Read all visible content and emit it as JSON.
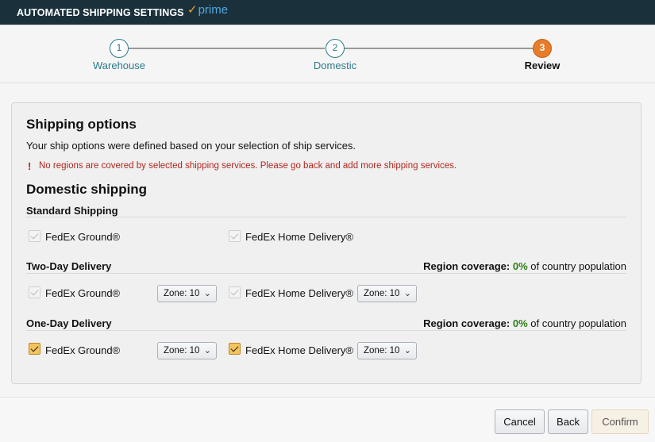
{
  "header": {
    "title": "AUTOMATED SHIPPING SETTINGS",
    "prime_check": "✓",
    "prime_text": "prime"
  },
  "steps": [
    {
      "number": "1",
      "label": "Warehouse"
    },
    {
      "number": "2",
      "label": "Domestic"
    },
    {
      "number": "3",
      "label": "Review"
    }
  ],
  "shipping_options": {
    "title": "Shipping options",
    "description": "Your ship options were defined based on your selection of ship services.",
    "error_icon": "!",
    "error": "No regions are covered by selected shipping services. Please go back and add more shipping services."
  },
  "domestic": {
    "title": "Domestic shipping",
    "standard": {
      "label": "Standard Shipping",
      "services": [
        "FedEx Ground®",
        "FedEx Home Delivery®"
      ]
    },
    "two_day": {
      "label": "Two-Day Delivery",
      "coverage_label": "Region coverage:",
      "coverage_pct": "0%",
      "coverage_suffix": "of country population",
      "services": [
        "FedEx Ground®",
        "FedEx Home Delivery®"
      ],
      "zones": [
        "Zone: 10",
        "Zone: 10"
      ]
    },
    "one_day": {
      "label": "One-Day Delivery",
      "coverage_label": "Region coverage:",
      "coverage_pct": "0%",
      "coverage_suffix": "of country population",
      "services": [
        "FedEx Ground®",
        "FedEx Home Delivery®"
      ],
      "zones": [
        "Zone: 10",
        "Zone: 10"
      ]
    }
  },
  "footer": {
    "cancel": "Cancel",
    "back": "Back",
    "confirm": "Confirm"
  },
  "colors": {
    "header_bg": "#1a313c",
    "active_step": "#e77c2a",
    "step_link": "#2b7b8a",
    "error": "#b3261e",
    "coverage_pct": "#2e7d18"
  }
}
